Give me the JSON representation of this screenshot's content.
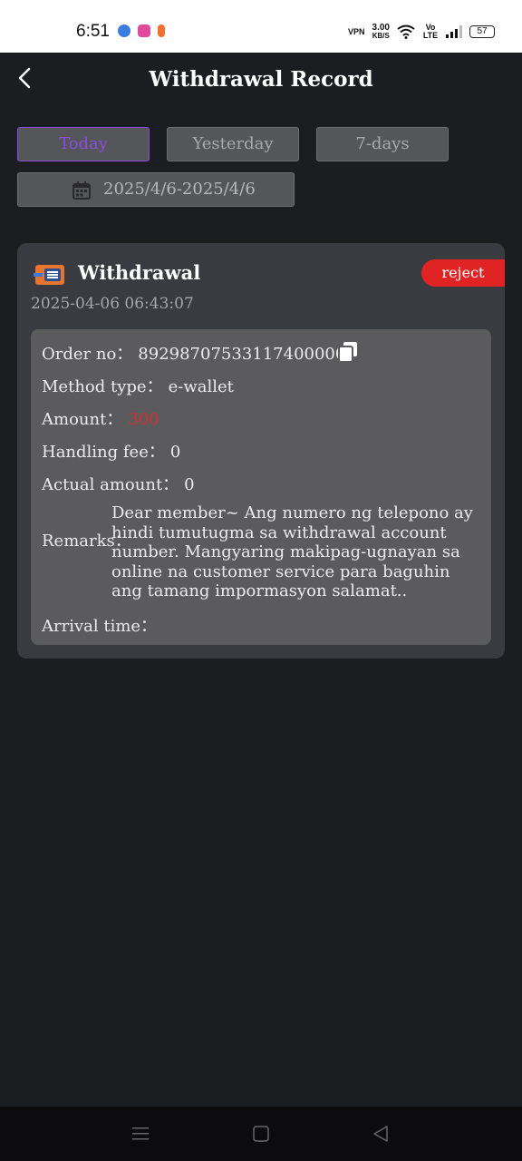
{
  "status_bar": {
    "time": "6:51",
    "app_icon_colors": [
      "#3a7de0",
      "#e04a9a",
      "#f07030"
    ],
    "vpn": "VPN",
    "speed_value": "3.00",
    "speed_unit": "KB/S",
    "network": "Vo LTE",
    "battery": "57"
  },
  "header": {
    "back_icon": "chevron-left-icon",
    "title": "Withdrawal Record"
  },
  "filters": {
    "tabs": [
      {
        "label": "Today",
        "active": true
      },
      {
        "label": "Yesterday",
        "active": false
      },
      {
        "label": "7-days",
        "active": false
      }
    ],
    "date_range": "2025/4/6-2025/4/6"
  },
  "record": {
    "title": "Withdrawal",
    "status": "reject",
    "status_color": "#e02424",
    "datetime": "2025-04-06 06:43:07",
    "order_label": "Order no：",
    "order_no": "892987075331174000001",
    "method_label": "Method type：",
    "method": "e-wallet",
    "amount_label": "Amount：",
    "amount": "300",
    "fee_label": "Handling fee：",
    "fee": "0",
    "actual_label": "Actual amount：",
    "actual": "0",
    "remarks_label": "Remarks：",
    "remarks": "Dear member~ Ang numero ng telepono ay hindi tumutugma sa withdrawal account number. Mangyaring makipag-ugnayan sa online na customer service para baguhin ang tamang impormasyon salamat..",
    "arrival_label": "Arrival time：",
    "arrival": ""
  },
  "accent_color": "#8a4de0"
}
